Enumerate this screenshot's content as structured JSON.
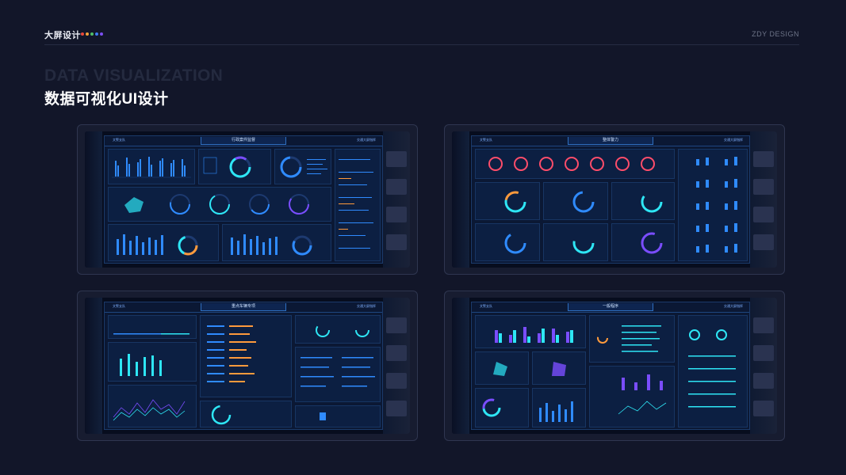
{
  "header": {
    "brand": "大屏设计",
    "brand_dots": [
      "#e8483b",
      "#f2a23a",
      "#4fbf67",
      "#3d7bf2",
      "#7b4ff2"
    ],
    "studio": "ZDY DESIGN"
  },
  "hero": {
    "background_title": "DATA VISUALIZATION",
    "title": "数据可视化UI设计"
  },
  "dashboards": [
    {
      "title": "行政案件监督",
      "sub": "文警支队",
      "top_right": "交通大屏指挥"
    },
    {
      "title": "整体警力",
      "sub": "文警支队",
      "top_right": "交通大屏指挥"
    },
    {
      "title": "重点车辆专项",
      "sub": "文警支队",
      "top_right": "交通大屏指挥"
    },
    {
      "title": "一般程序",
      "sub": "文警支队",
      "top_right": "交通大屏指挥"
    }
  ],
  "colors": {
    "accent": "#2f8bff",
    "cyan": "#2ee6f5",
    "purple": "#7a4dff",
    "orange": "#ff9a3c"
  }
}
